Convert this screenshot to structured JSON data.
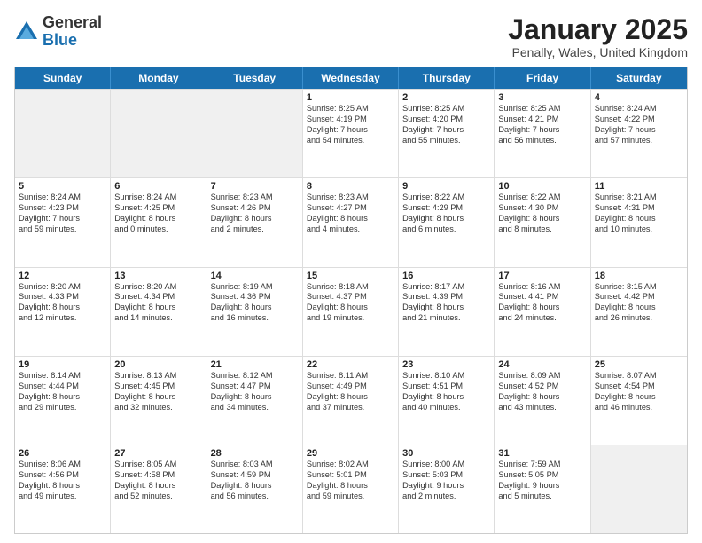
{
  "logo": {
    "general": "General",
    "blue": "Blue"
  },
  "title": "January 2025",
  "subtitle": "Penally, Wales, United Kingdom",
  "days": [
    "Sunday",
    "Monday",
    "Tuesday",
    "Wednesday",
    "Thursday",
    "Friday",
    "Saturday"
  ],
  "rows": [
    [
      {
        "day": "",
        "lines": [],
        "shaded": true
      },
      {
        "day": "",
        "lines": [],
        "shaded": true
      },
      {
        "day": "",
        "lines": [],
        "shaded": true
      },
      {
        "day": "1",
        "lines": [
          "Sunrise: 8:25 AM",
          "Sunset: 4:19 PM",
          "Daylight: 7 hours",
          "and 54 minutes."
        ]
      },
      {
        "day": "2",
        "lines": [
          "Sunrise: 8:25 AM",
          "Sunset: 4:20 PM",
          "Daylight: 7 hours",
          "and 55 minutes."
        ]
      },
      {
        "day": "3",
        "lines": [
          "Sunrise: 8:25 AM",
          "Sunset: 4:21 PM",
          "Daylight: 7 hours",
          "and 56 minutes."
        ]
      },
      {
        "day": "4",
        "lines": [
          "Sunrise: 8:24 AM",
          "Sunset: 4:22 PM",
          "Daylight: 7 hours",
          "and 57 minutes."
        ]
      }
    ],
    [
      {
        "day": "5",
        "lines": [
          "Sunrise: 8:24 AM",
          "Sunset: 4:23 PM",
          "Daylight: 7 hours",
          "and 59 minutes."
        ]
      },
      {
        "day": "6",
        "lines": [
          "Sunrise: 8:24 AM",
          "Sunset: 4:25 PM",
          "Daylight: 8 hours",
          "and 0 minutes."
        ]
      },
      {
        "day": "7",
        "lines": [
          "Sunrise: 8:23 AM",
          "Sunset: 4:26 PM",
          "Daylight: 8 hours",
          "and 2 minutes."
        ]
      },
      {
        "day": "8",
        "lines": [
          "Sunrise: 8:23 AM",
          "Sunset: 4:27 PM",
          "Daylight: 8 hours",
          "and 4 minutes."
        ]
      },
      {
        "day": "9",
        "lines": [
          "Sunrise: 8:22 AM",
          "Sunset: 4:29 PM",
          "Daylight: 8 hours",
          "and 6 minutes."
        ]
      },
      {
        "day": "10",
        "lines": [
          "Sunrise: 8:22 AM",
          "Sunset: 4:30 PM",
          "Daylight: 8 hours",
          "and 8 minutes."
        ]
      },
      {
        "day": "11",
        "lines": [
          "Sunrise: 8:21 AM",
          "Sunset: 4:31 PM",
          "Daylight: 8 hours",
          "and 10 minutes."
        ]
      }
    ],
    [
      {
        "day": "12",
        "lines": [
          "Sunrise: 8:20 AM",
          "Sunset: 4:33 PM",
          "Daylight: 8 hours",
          "and 12 minutes."
        ]
      },
      {
        "day": "13",
        "lines": [
          "Sunrise: 8:20 AM",
          "Sunset: 4:34 PM",
          "Daylight: 8 hours",
          "and 14 minutes."
        ]
      },
      {
        "day": "14",
        "lines": [
          "Sunrise: 8:19 AM",
          "Sunset: 4:36 PM",
          "Daylight: 8 hours",
          "and 16 minutes."
        ]
      },
      {
        "day": "15",
        "lines": [
          "Sunrise: 8:18 AM",
          "Sunset: 4:37 PM",
          "Daylight: 8 hours",
          "and 19 minutes."
        ]
      },
      {
        "day": "16",
        "lines": [
          "Sunrise: 8:17 AM",
          "Sunset: 4:39 PM",
          "Daylight: 8 hours",
          "and 21 minutes."
        ]
      },
      {
        "day": "17",
        "lines": [
          "Sunrise: 8:16 AM",
          "Sunset: 4:41 PM",
          "Daylight: 8 hours",
          "and 24 minutes."
        ]
      },
      {
        "day": "18",
        "lines": [
          "Sunrise: 8:15 AM",
          "Sunset: 4:42 PM",
          "Daylight: 8 hours",
          "and 26 minutes."
        ]
      }
    ],
    [
      {
        "day": "19",
        "lines": [
          "Sunrise: 8:14 AM",
          "Sunset: 4:44 PM",
          "Daylight: 8 hours",
          "and 29 minutes."
        ]
      },
      {
        "day": "20",
        "lines": [
          "Sunrise: 8:13 AM",
          "Sunset: 4:45 PM",
          "Daylight: 8 hours",
          "and 32 minutes."
        ]
      },
      {
        "day": "21",
        "lines": [
          "Sunrise: 8:12 AM",
          "Sunset: 4:47 PM",
          "Daylight: 8 hours",
          "and 34 minutes."
        ]
      },
      {
        "day": "22",
        "lines": [
          "Sunrise: 8:11 AM",
          "Sunset: 4:49 PM",
          "Daylight: 8 hours",
          "and 37 minutes."
        ]
      },
      {
        "day": "23",
        "lines": [
          "Sunrise: 8:10 AM",
          "Sunset: 4:51 PM",
          "Daylight: 8 hours",
          "and 40 minutes."
        ]
      },
      {
        "day": "24",
        "lines": [
          "Sunrise: 8:09 AM",
          "Sunset: 4:52 PM",
          "Daylight: 8 hours",
          "and 43 minutes."
        ]
      },
      {
        "day": "25",
        "lines": [
          "Sunrise: 8:07 AM",
          "Sunset: 4:54 PM",
          "Daylight: 8 hours",
          "and 46 minutes."
        ]
      }
    ],
    [
      {
        "day": "26",
        "lines": [
          "Sunrise: 8:06 AM",
          "Sunset: 4:56 PM",
          "Daylight: 8 hours",
          "and 49 minutes."
        ]
      },
      {
        "day": "27",
        "lines": [
          "Sunrise: 8:05 AM",
          "Sunset: 4:58 PM",
          "Daylight: 8 hours",
          "and 52 minutes."
        ]
      },
      {
        "day": "28",
        "lines": [
          "Sunrise: 8:03 AM",
          "Sunset: 4:59 PM",
          "Daylight: 8 hours",
          "and 56 minutes."
        ]
      },
      {
        "day": "29",
        "lines": [
          "Sunrise: 8:02 AM",
          "Sunset: 5:01 PM",
          "Daylight: 8 hours",
          "and 59 minutes."
        ]
      },
      {
        "day": "30",
        "lines": [
          "Sunrise: 8:00 AM",
          "Sunset: 5:03 PM",
          "Daylight: 9 hours",
          "and 2 minutes."
        ]
      },
      {
        "day": "31",
        "lines": [
          "Sunrise: 7:59 AM",
          "Sunset: 5:05 PM",
          "Daylight: 9 hours",
          "and 5 minutes."
        ]
      },
      {
        "day": "",
        "lines": [],
        "shaded": true
      }
    ]
  ]
}
